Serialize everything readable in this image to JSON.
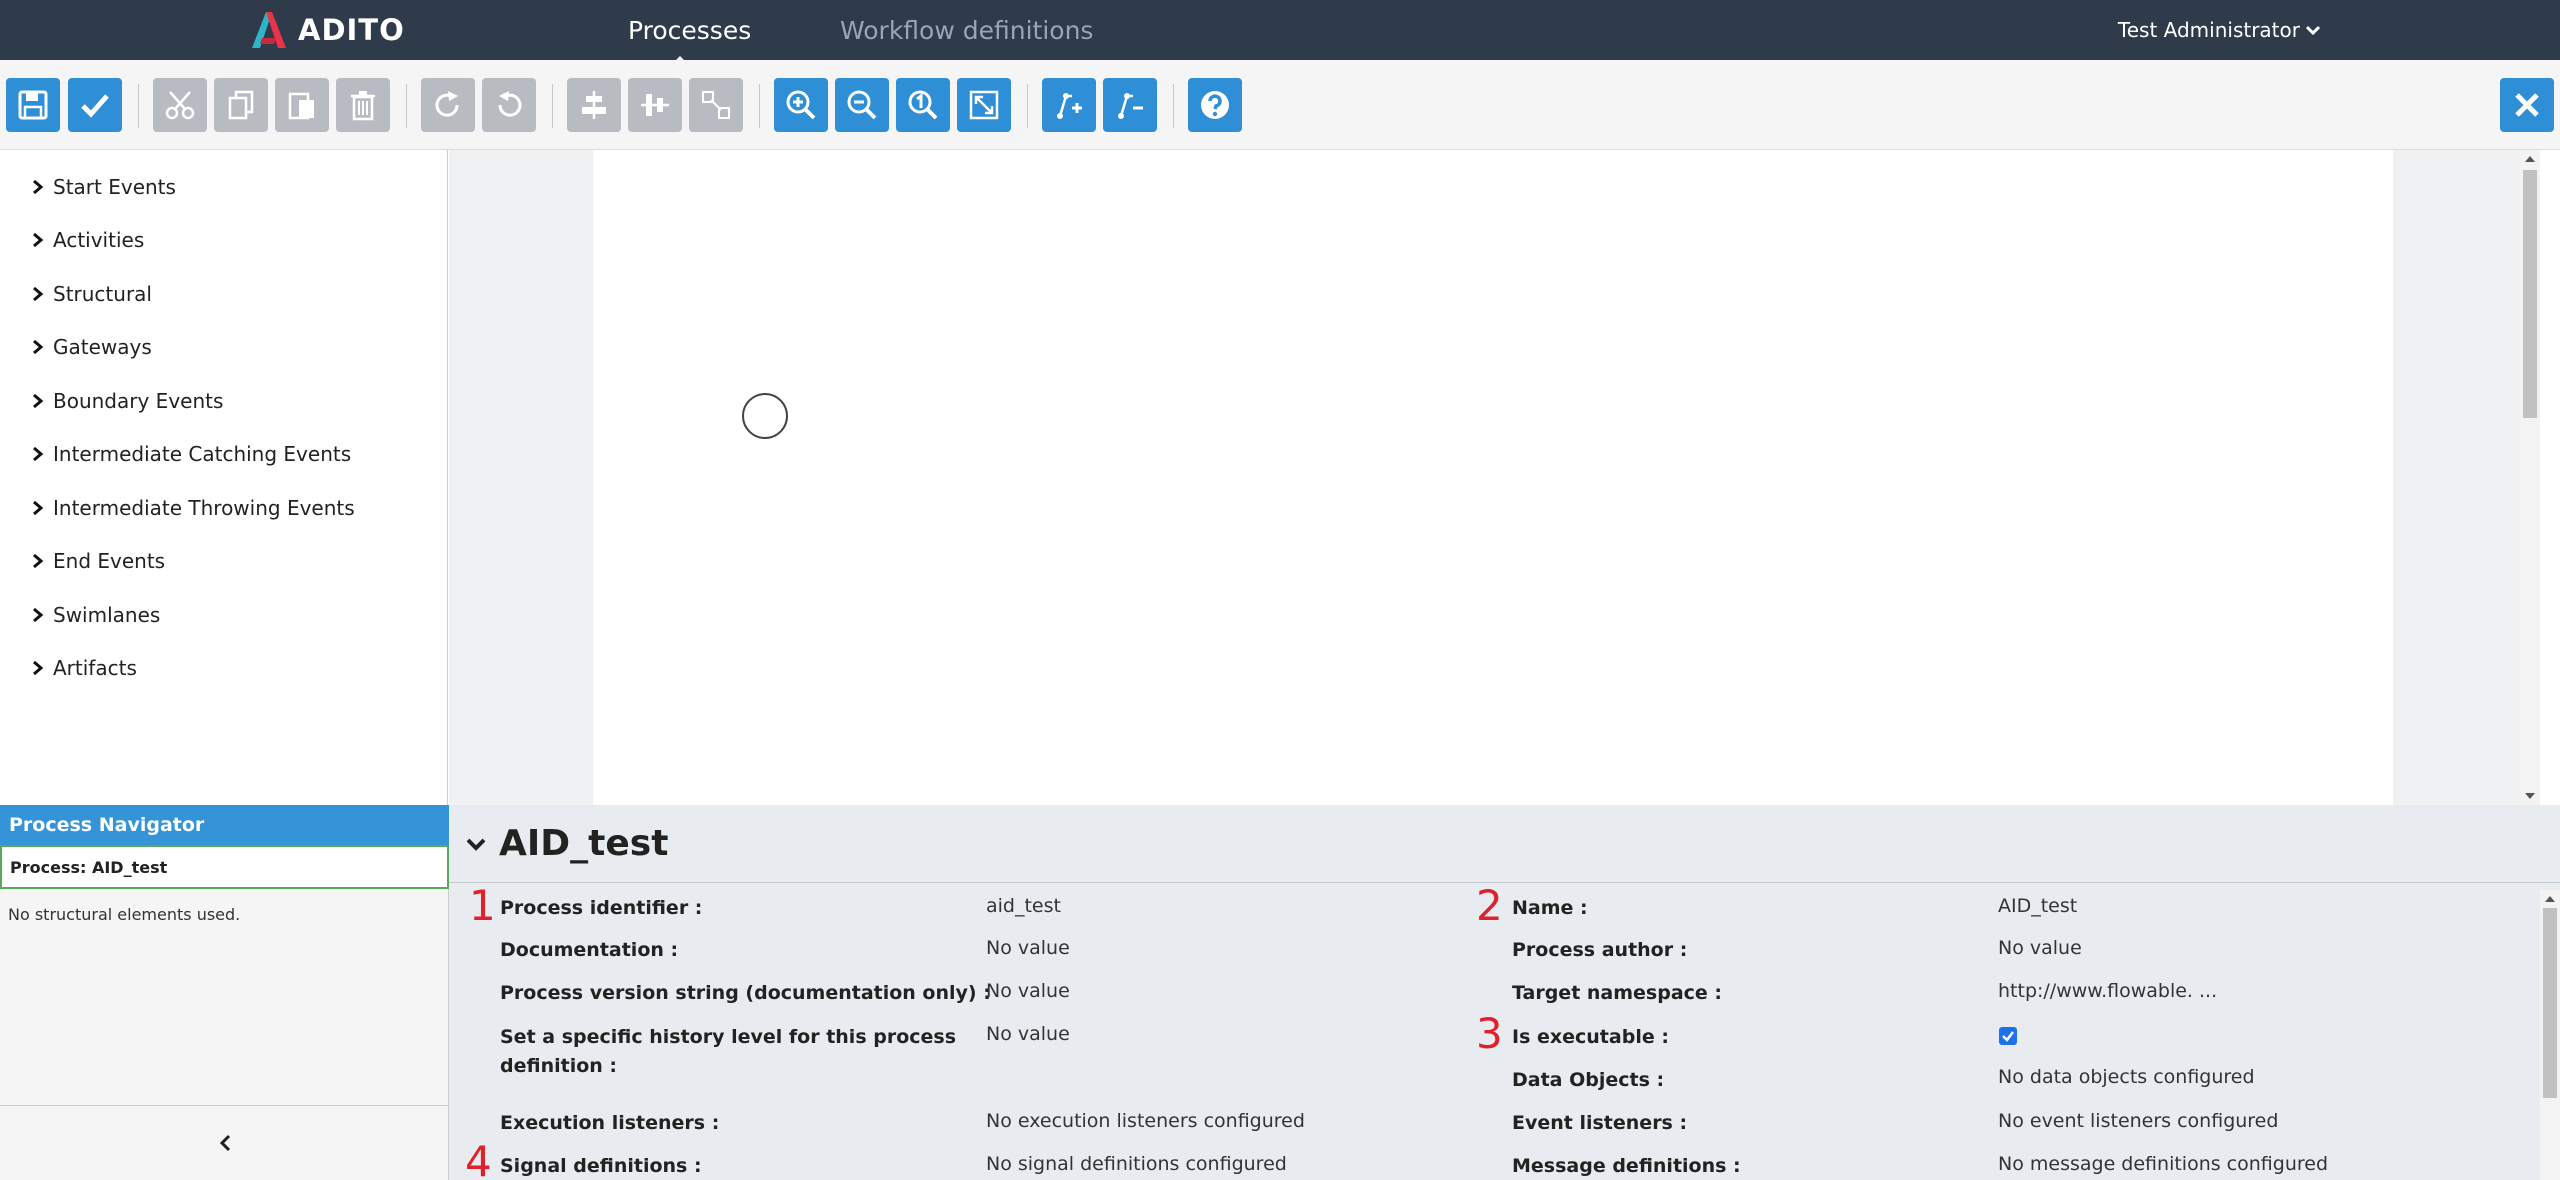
{
  "header": {
    "logo_text": "ADITO",
    "nav": [
      {
        "label": "Processes",
        "active": true
      },
      {
        "label": "Workflow definitions",
        "active": false
      }
    ],
    "user": "Test Administrator"
  },
  "toolbar": {
    "buttons": [
      {
        "icon": "save-icon",
        "enabled": true
      },
      {
        "icon": "check-icon",
        "enabled": true
      },
      {
        "icon": "cut-icon",
        "enabled": false
      },
      {
        "icon": "copy-icon",
        "enabled": false
      },
      {
        "icon": "paste-icon",
        "enabled": false
      },
      {
        "icon": "delete-icon",
        "enabled": false
      },
      {
        "icon": "redo-icon",
        "enabled": false
      },
      {
        "icon": "undo-icon",
        "enabled": false
      },
      {
        "icon": "align-horizontal-icon",
        "enabled": false
      },
      {
        "icon": "align-vertical-icon",
        "enabled": false
      },
      {
        "icon": "same-size-icon",
        "enabled": false
      },
      {
        "icon": "zoom-in-icon",
        "enabled": true
      },
      {
        "icon": "zoom-out-icon",
        "enabled": true
      },
      {
        "icon": "zoom-actual-icon",
        "enabled": true
      },
      {
        "icon": "zoom-fit-icon",
        "enabled": true
      },
      {
        "icon": "add-bendpoint-icon",
        "enabled": true
      },
      {
        "icon": "remove-bendpoint-icon",
        "enabled": true
      },
      {
        "icon": "help-icon",
        "enabled": true
      },
      {
        "icon": "close-icon",
        "enabled": true
      }
    ]
  },
  "palette": {
    "items": [
      "Start Events",
      "Activities",
      "Structural",
      "Gateways",
      "Boundary Events",
      "Intermediate Catching Events",
      "Intermediate Throwing Events",
      "End Events",
      "Swimlanes",
      "Artifacts"
    ]
  },
  "navigator": {
    "title": "Process Navigator",
    "process": "Process: AID_test",
    "empty_text": "No structural elements used."
  },
  "properties": {
    "title": "AID_test",
    "left": [
      {
        "label": "Process identifier :",
        "value": "aid_test"
      },
      {
        "label": "Documentation :",
        "value": "No value"
      },
      {
        "label": "Process version string (documentation only) :",
        "value": "No value"
      },
      {
        "label": "Set a specific history level for this process",
        "label2": "definition :",
        "value": "No value"
      },
      {
        "label": "Execution listeners :",
        "value": "No execution listeners configured"
      },
      {
        "label": "Signal definitions :",
        "value": "No signal definitions configured"
      }
    ],
    "right": [
      {
        "label": "Name :",
        "value": "AID_test"
      },
      {
        "label": "Process author :",
        "value": "No value"
      },
      {
        "label": "Target namespace :",
        "value": "http://www.flowable. ..."
      },
      {
        "label": "Is executable :",
        "value": ""
      },
      {
        "label": "Data Objects :",
        "value": "No data objects configured"
      },
      {
        "label": "Event listeners :",
        "value": "No event listeners configured"
      },
      {
        "label": "Message definitions :",
        "value": "No message definitions configured"
      }
    ],
    "is_executable": true,
    "annotations": [
      "1",
      "2",
      "3",
      "4"
    ]
  },
  "colors": {
    "header_bg": "#2f3a4b",
    "accent": "#2e8fd6",
    "annotation": "#e0202a"
  }
}
